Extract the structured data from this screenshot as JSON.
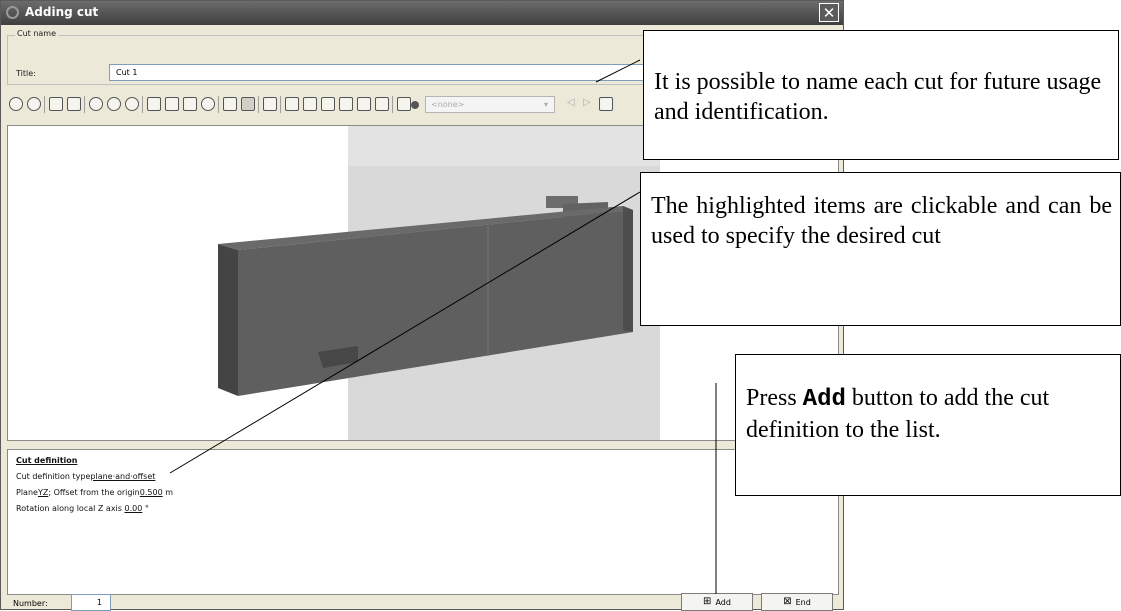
{
  "window": {
    "title": "Adding cut",
    "close_glyph": "✕"
  },
  "cut_name": {
    "group_label": "Cut name",
    "title_label": "Title:",
    "title_value": "Cut 1"
  },
  "toolbar": {
    "combo_value": "<none>",
    "combo_arrow": "▾",
    "prev_glyph": "◁",
    "next_glyph": "▷",
    "icons": [
      "move-icon",
      "rotate-icon",
      "cube-view-icon",
      "cube-view-2-icon",
      "zoom-in-icon",
      "zoom-out-icon",
      "zoom-fit-icon",
      "frame-icon",
      "frame-2-icon",
      "frame-3-icon",
      "zoom-window-icon",
      "light-icon",
      "light-2-icon",
      "axes-icon",
      "view-front-icon",
      "view-back-icon",
      "view-left-icon",
      "view-right-icon",
      "view-top-icon",
      "view-bottom-icon",
      "list-icon",
      "dot-icon",
      "export-icon"
    ]
  },
  "definition": {
    "heading": "Cut definition",
    "type_label": "Cut definition type",
    "type_value": "plane·and·offset",
    "plane_prefix": "Plane",
    "plane_value": "YZ",
    "offset_label": "; Offset from the origin",
    "offset_value": "0.500",
    "offset_unit": " m",
    "rotation_label": "Rotation along local Z axis ",
    "rotation_value": "0.00",
    "rotation_unit": " °"
  },
  "footer": {
    "number_label": "Number:",
    "number_value": "1",
    "add_label": "Add",
    "end_label": "End"
  },
  "callouts": {
    "name_text": "It is possible to name each cut for future usage and identification.",
    "highlight_text": "The highlighted items are clickable and can be used to specify the desired cut",
    "add_prefix": "Press ",
    "add_keyword": "Add",
    "add_suffix": " button to add the cut definition to the list."
  },
  "colors": {
    "window_bg": "#ece9d8",
    "titlebar": "#4a4a4a",
    "model_face": "#5f5f5f",
    "cut_plane": "#d9d9d9"
  }
}
